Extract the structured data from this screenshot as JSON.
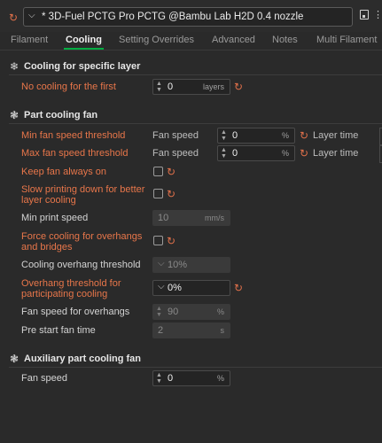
{
  "header": {
    "preset_name": "* 3D-Fuel PCTG Pro PCTG @Bambu Lab H2D 0.4 nozzle",
    "icons": [
      "reset-icon",
      "chevron-down-icon",
      "save-icon",
      "more-icon"
    ]
  },
  "tabs": [
    {
      "label": "Filament",
      "active": false
    },
    {
      "label": "Cooling",
      "active": true
    },
    {
      "label": "Setting Overrides",
      "active": false
    },
    {
      "label": "Advanced",
      "active": false
    },
    {
      "label": "Notes",
      "active": false
    },
    {
      "label": "Multi Filament",
      "active": false
    }
  ],
  "sections": {
    "cooling_layer": {
      "title": "Cooling for specific layer",
      "no_cooling": {
        "label": "No cooling for the first",
        "value": "0",
        "unit": "layers"
      }
    },
    "part_fan": {
      "title": "Part cooling fan",
      "min_fan": {
        "label": "Min fan speed threshold",
        "sub": "Fan speed",
        "value": "0",
        "unit": "%",
        "sub2": "Layer time"
      },
      "max_fan": {
        "label": "Max fan speed threshold",
        "sub": "Fan speed",
        "value": "0",
        "unit": "%",
        "sub2": "Layer time"
      },
      "keep_fan": {
        "label": "Keep fan always on",
        "checked": false
      },
      "slow_down": {
        "label_line1": "Slow printing down for better",
        "label_line2": "layer cooling",
        "checked": false
      },
      "min_speed": {
        "label": "Min print speed",
        "value": "10",
        "unit": "mm/s"
      },
      "force_cooling": {
        "label_line1": "Force cooling for overhangs",
        "label_line2": "and bridges",
        "checked": false
      },
      "overhang_threshold": {
        "label": "Cooling overhang threshold",
        "value": "10%"
      },
      "overhang_participating": {
        "label_line1": "Overhang threshold for",
        "label_line2": "participating cooling",
        "value": "0%"
      },
      "fan_overhangs": {
        "label": "Fan speed for overhangs",
        "value": "90",
        "unit": "%"
      },
      "pre_start": {
        "label": "Pre start fan time",
        "value": "2",
        "unit": "s"
      }
    },
    "aux_fan": {
      "title": "Auxiliary part cooling fan",
      "fan_speed": {
        "label": "Fan speed",
        "value": "0",
        "unit": "%"
      }
    }
  },
  "colors": {
    "accent_green": "#00ae42",
    "modified_orange": "#e8764a",
    "background": "#2a2a2a"
  }
}
